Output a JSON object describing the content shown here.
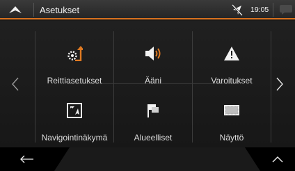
{
  "header": {
    "title": "Asetukset",
    "clock": "19:05"
  },
  "accent_color": "#d8711e",
  "menu": {
    "items": [
      {
        "label": "Reittiasetukset",
        "icon": "route-settings-icon"
      },
      {
        "label": "Ääni",
        "icon": "speaker-icon"
      },
      {
        "label": "Varoitukset",
        "icon": "warning-icon"
      },
      {
        "label": "Navigointinäkymä",
        "icon": "navigation-view-icon"
      },
      {
        "label": "Alueelliset",
        "icon": "flag-icon"
      },
      {
        "label": "Näyttö",
        "icon": "display-icon"
      }
    ]
  }
}
